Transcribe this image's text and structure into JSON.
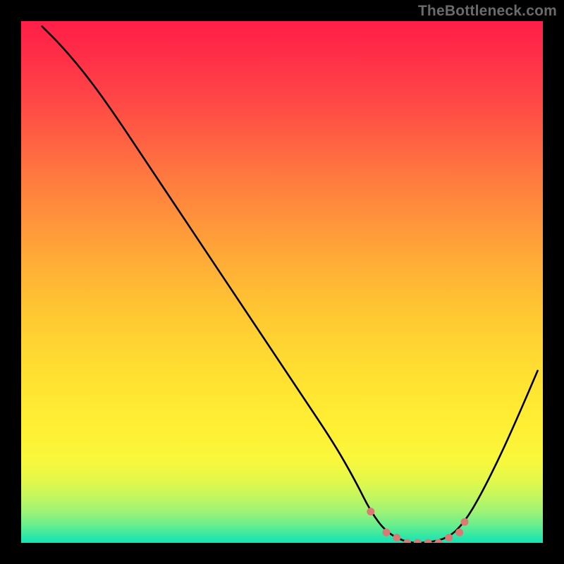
{
  "watermark": "TheBottleneck.com",
  "chart_data": {
    "type": "line",
    "title": "",
    "xlabel": "",
    "ylabel": "",
    "xlim": [
      0,
      100
    ],
    "ylim": [
      0,
      100
    ],
    "grid": false,
    "background": "gradient-red-to-green",
    "annotations": [],
    "curve": [
      {
        "x": 4,
        "y": 99
      },
      {
        "x": 8,
        "y": 95
      },
      {
        "x": 13,
        "y": 89
      },
      {
        "x": 18,
        "y": 82
      },
      {
        "x": 24,
        "y": 73
      },
      {
        "x": 30,
        "y": 64
      },
      {
        "x": 36,
        "y": 55
      },
      {
        "x": 42,
        "y": 46
      },
      {
        "x": 48,
        "y": 37
      },
      {
        "x": 54,
        "y": 28
      },
      {
        "x": 60,
        "y": 19
      },
      {
        "x": 64,
        "y": 12
      },
      {
        "x": 67,
        "y": 6
      },
      {
        "x": 70,
        "y": 2
      },
      {
        "x": 74,
        "y": 0
      },
      {
        "x": 78,
        "y": 0
      },
      {
        "x": 82,
        "y": 1
      },
      {
        "x": 85,
        "y": 4
      },
      {
        "x": 88,
        "y": 9
      },
      {
        "x": 92,
        "y": 17
      },
      {
        "x": 96,
        "y": 26
      },
      {
        "x": 99,
        "y": 33
      }
    ],
    "marker_region": {
      "x_start": 67,
      "x_end": 85
    },
    "markers": [
      {
        "x": 67,
        "y": 6
      },
      {
        "x": 70,
        "y": 2
      },
      {
        "x": 72,
        "y": 1
      },
      {
        "x": 74,
        "y": 0
      },
      {
        "x": 76,
        "y": 0
      },
      {
        "x": 78,
        "y": 0
      },
      {
        "x": 80,
        "y": 0
      },
      {
        "x": 82,
        "y": 1
      },
      {
        "x": 84,
        "y": 2
      },
      {
        "x": 85,
        "y": 4
      }
    ]
  },
  "colors": {
    "curve": "#000000",
    "markers": "#d97a74",
    "watermark": "#6a6a6a",
    "frame": "#000000"
  }
}
